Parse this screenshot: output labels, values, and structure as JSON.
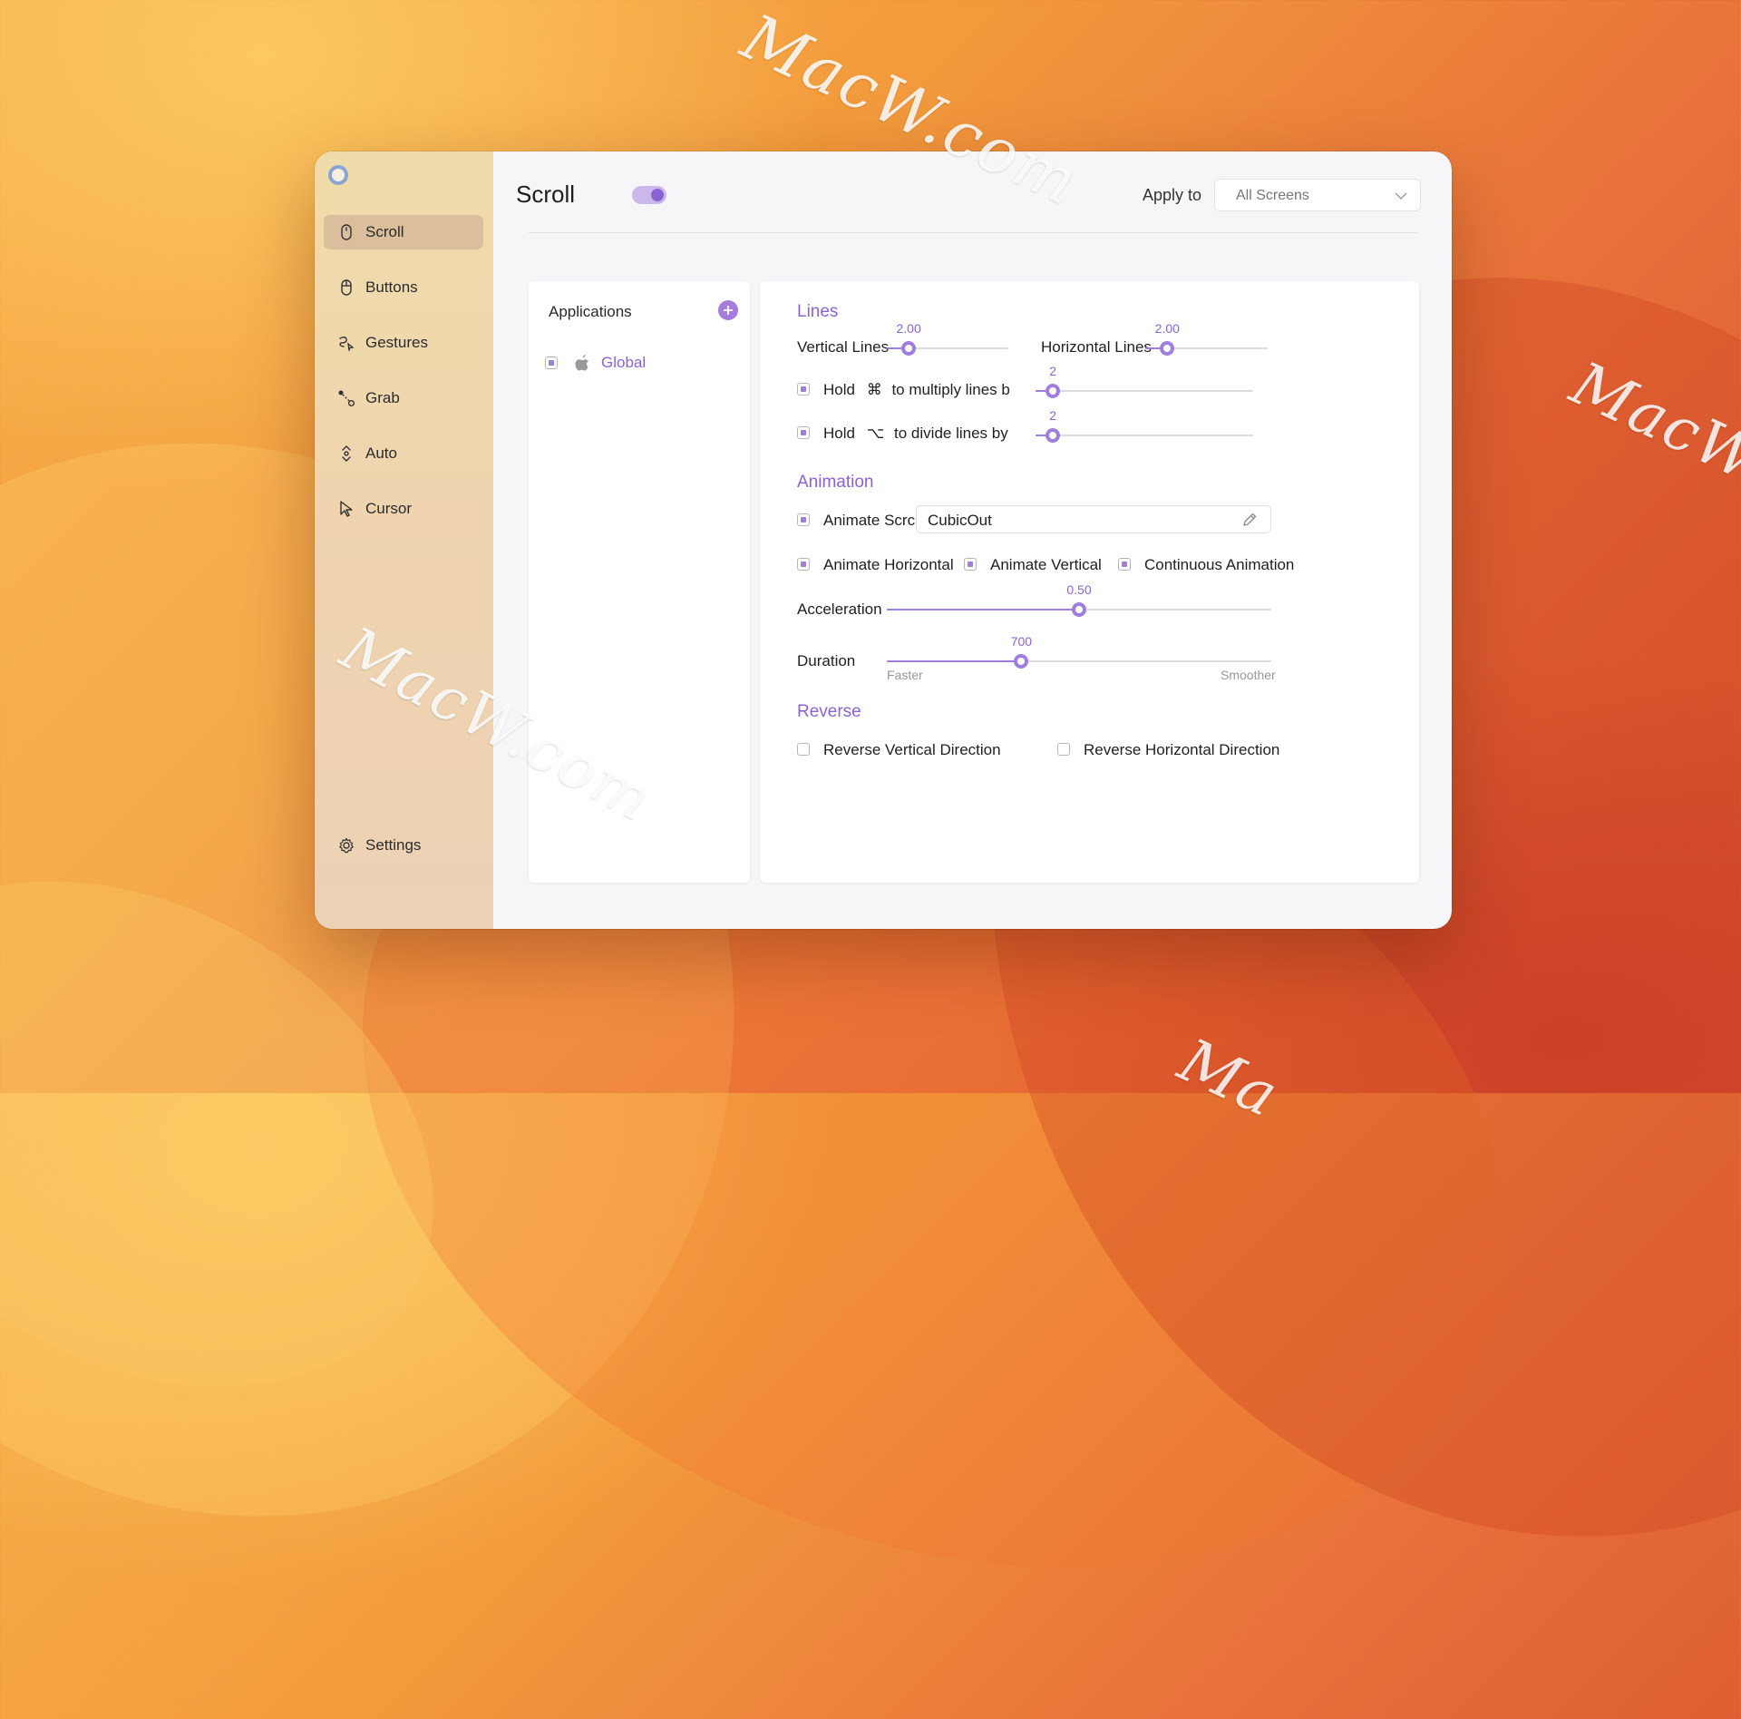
{
  "watermark": "MacW.com",
  "watermark_partial": "Ma",
  "sidebar": {
    "items": [
      {
        "label": "Scroll",
        "icon": "mouse-icon",
        "active": true
      },
      {
        "label": "Buttons",
        "icon": "mouse-buttons-icon"
      },
      {
        "label": "Gestures",
        "icon": "gesture-icon"
      },
      {
        "label": "Grab",
        "icon": "grab-icon"
      },
      {
        "label": "Auto",
        "icon": "auto-scroll-icon"
      },
      {
        "label": "Cursor",
        "icon": "cursor-arrow-icon"
      }
    ],
    "settings_label": "Settings"
  },
  "header": {
    "title": "Scroll",
    "enabled": true,
    "apply_to_label": "Apply to",
    "apply_to_value": "All Screens"
  },
  "applications": {
    "title": "Applications",
    "items": [
      {
        "label": "Global",
        "icon": "apple-logo-icon",
        "checked": true
      }
    ]
  },
  "lines": {
    "title": "Lines",
    "vertical": {
      "label": "Vertical Lines",
      "value": "2.00",
      "fraction": 0.18
    },
    "horizontal": {
      "label": "Horizontal Lines",
      "value": "2.00",
      "fraction": 0.18
    },
    "multiply": {
      "prefix": "Hold",
      "key": "⌘",
      "suffix": "to multiply lines b",
      "checked": true,
      "value": "2",
      "fraction": 0.08
    },
    "divide": {
      "prefix": "Hold",
      "key": "⌥",
      "suffix": "to divide lines by",
      "checked": true,
      "value": "2",
      "fraction": 0.08
    }
  },
  "animation": {
    "title": "Animation",
    "animate_scroll": {
      "label": "Animate Scrc",
      "checked": true
    },
    "curve": "CubicOut",
    "animate_horizontal": {
      "label": "Animate Horizontal",
      "checked": true
    },
    "animate_vertical": {
      "label": "Animate Vertical",
      "checked": true
    },
    "continuous": {
      "label": "Continuous Animation",
      "checked": true
    },
    "acceleration": {
      "label": "Acceleration",
      "value": "0.50",
      "fraction": 0.5
    },
    "duration": {
      "label": "Duration",
      "value": "700",
      "fraction": 0.35,
      "min_label": "Faster",
      "max_label": "Smoother"
    }
  },
  "reverse": {
    "title": "Reverse",
    "vertical": {
      "label": "Reverse Vertical Direction",
      "checked": false
    },
    "horizontal": {
      "label": "Reverse Horizontal Direction",
      "checked": false
    }
  }
}
